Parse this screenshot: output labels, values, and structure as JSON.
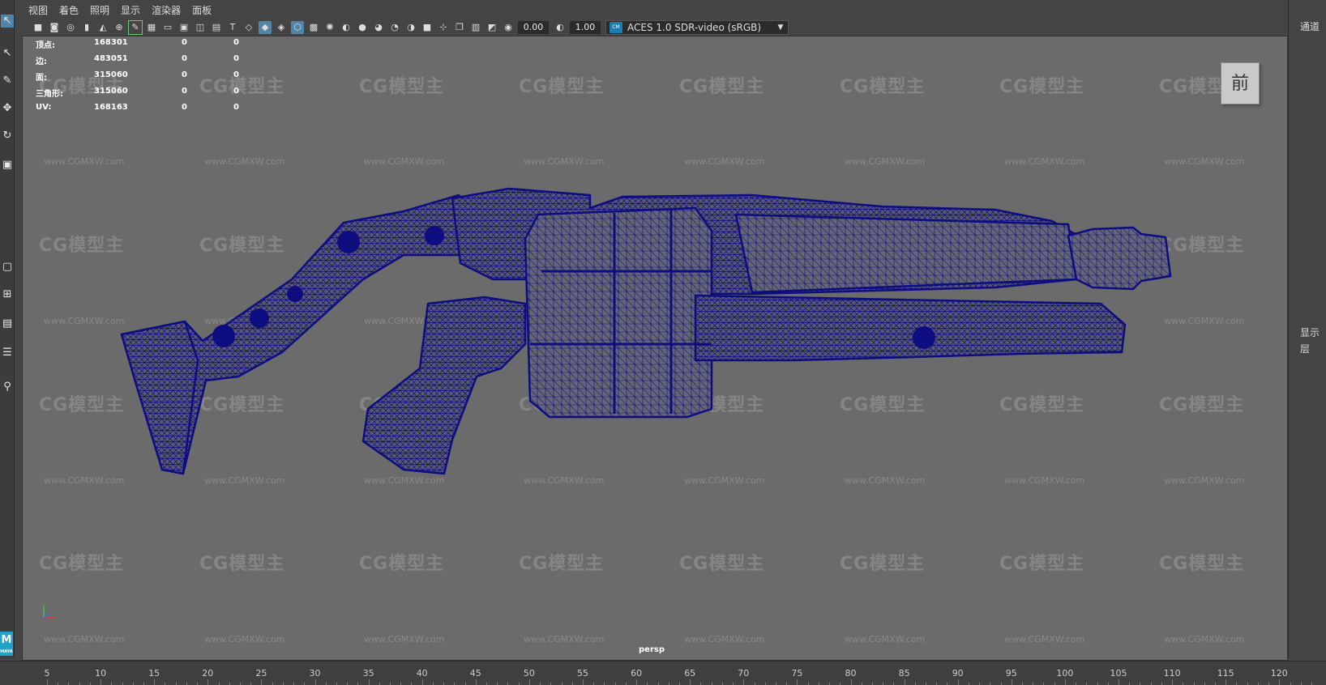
{
  "panel_menu": [
    "视图",
    "着色",
    "照明",
    "显示",
    "渲染器",
    "面板"
  ],
  "toolbar": {
    "exposure_value": "0.00",
    "gamma_value": "1.00",
    "color_space": "ACES 1.0 SDR-video (sRGB)",
    "icons": [
      "camera-icon",
      "camera-attr-icon",
      "bookmark-icon",
      "image-plane-icon",
      "grease-pencil-icon",
      "grid-icon",
      "film-gate-icon",
      "resolution-gate-icon",
      "safe-action-icon",
      "wireframe-icon",
      "smooth-shade-icon",
      "wireframe-on-shaded-icon",
      "textured-icon",
      "lights-icon",
      "shadows-icon",
      "ao-icon",
      "motion-blur-icon",
      "aa-icon",
      "isolate-icon",
      "xray-icon",
      "xray-joints-icon",
      "backface-icon",
      "exposure-icon",
      "gamma-icon"
    ]
  },
  "hud": {
    "rows": [
      {
        "label": "顶点:",
        "v1": "168301",
        "v2": "0",
        "v3": "0"
      },
      {
        "label": "边:",
        "v1": "483051",
        "v2": "0",
        "v3": "0"
      },
      {
        "label": "面:",
        "v1": "315060",
        "v2": "0",
        "v3": "0"
      },
      {
        "label": "三角形:",
        "v1": "315060",
        "v2": "0",
        "v3": "0"
      },
      {
        "label": "UV:",
        "v1": "168163",
        "v2": "0",
        "v3": "0"
      }
    ]
  },
  "view_cube_label": "前",
  "camera_name": "persp",
  "watermark": {
    "logo_text": "CG模型主",
    "url_text": "www.CGMXW.com"
  },
  "right_panel": {
    "channels_tab": "通道",
    "display_tab": "显示",
    "layers_tab": "层"
  },
  "maya_logo": {
    "letter": "M",
    "sub": "MAYA"
  },
  "timeline_ticks": [
    "5",
    "10",
    "15",
    "20",
    "25",
    "30",
    "35",
    "40",
    "45",
    "50",
    "55",
    "60",
    "65",
    "70",
    "75",
    "80",
    "85",
    "90",
    "95",
    "100",
    "105",
    "110",
    "115",
    "120"
  ],
  "colors": {
    "wireframe": "#0d0d80",
    "viewport_bg": "#6b6b6b",
    "accent": "#5285a6"
  }
}
